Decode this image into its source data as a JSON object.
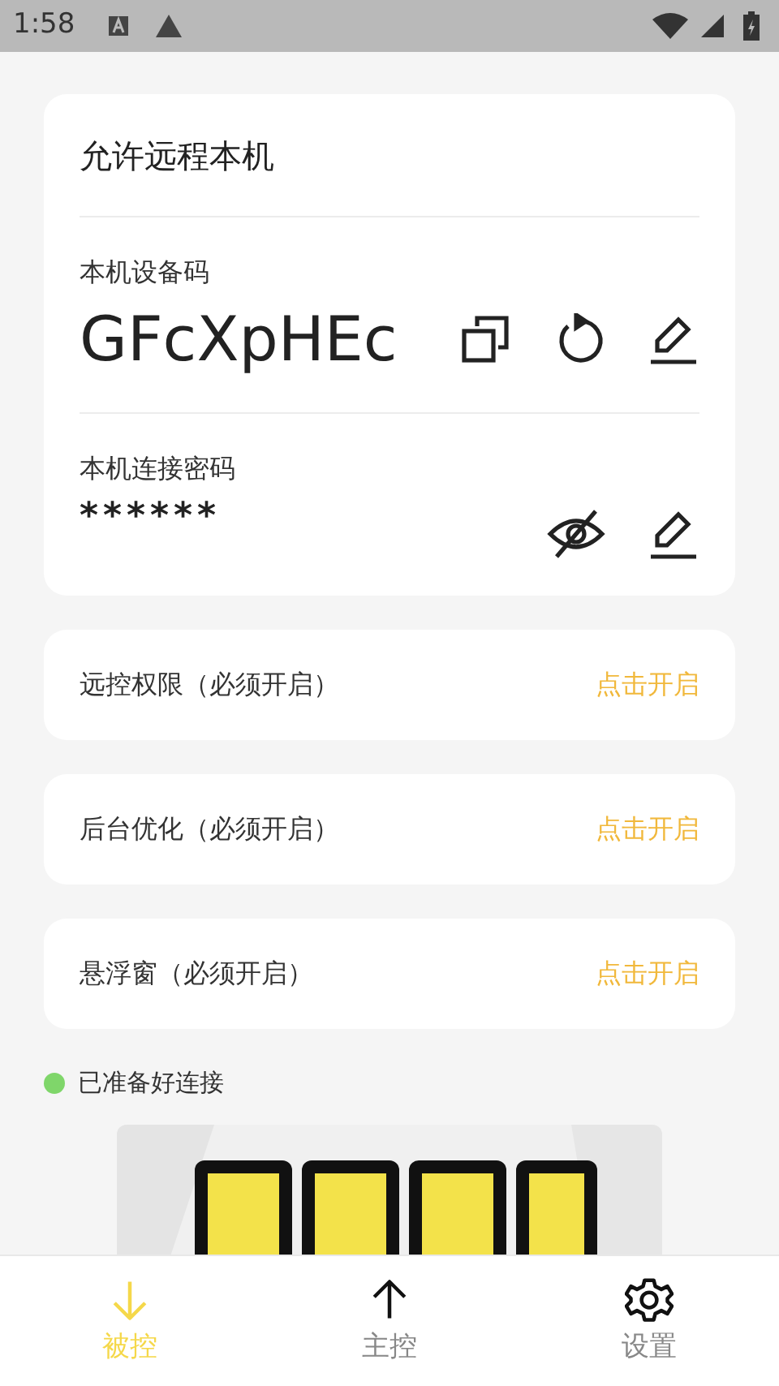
{
  "status_bar": {
    "time": "1:58"
  },
  "device_card": {
    "title": "允许远程本机",
    "code_label": "本机设备码",
    "code": "GFcXpHEc",
    "password_label": "本机连接密码",
    "password": "******"
  },
  "permissions": [
    {
      "label": "远控权限（必须开启）",
      "action": "点击开启"
    },
    {
      "label": "后台优化（必须开启）",
      "action": "点击开启"
    },
    {
      "label": "悬浮窗（必须开启）",
      "action": "点击开启"
    }
  ],
  "connection_status": {
    "text": "已准备好连接",
    "ready": true
  },
  "nav": [
    {
      "label": "被控",
      "kind": "incoming",
      "selected": true
    },
    {
      "label": "主控",
      "kind": "outgoing",
      "selected": false
    },
    {
      "label": "设置",
      "kind": "settings",
      "selected": false
    }
  ]
}
